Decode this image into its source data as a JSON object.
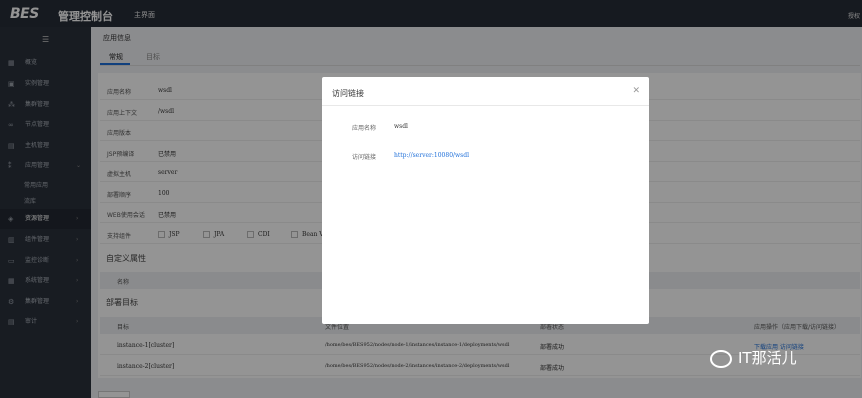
{
  "header": {
    "logo": "BES",
    "console": "管理控制台",
    "home_tab": "主界面",
    "auth": "授权"
  },
  "sidebar": {
    "items": [
      {
        "label": "概览",
        "icon": "grid-icon"
      },
      {
        "label": "实例管理",
        "icon": "instance-icon"
      },
      {
        "label": "集群管理",
        "icon": "cluster-icon"
      },
      {
        "label": "节点管理",
        "icon": "node-icon"
      },
      {
        "label": "主机管理",
        "icon": "host-icon"
      },
      {
        "label": "应用管理",
        "icon": "app-icon"
      },
      {
        "label": "常用应用",
        "icon": ""
      },
      {
        "label": "流库",
        "icon": ""
      },
      {
        "label": "资源管理",
        "icon": "resource-icon"
      },
      {
        "label": "组件管理",
        "icon": "component-icon"
      },
      {
        "label": "监控诊断",
        "icon": "monitor-icon"
      },
      {
        "label": "系统管理",
        "icon": "system-icon"
      },
      {
        "label": "集群管理",
        "icon": "gear-icon"
      },
      {
        "label": "审计",
        "icon": "audit-icon"
      }
    ]
  },
  "breadcrumb": "应用信息",
  "tabs": {
    "general": "常规",
    "target": "目标"
  },
  "info_rows": [
    {
      "k": "应用名称",
      "v": "wsdl"
    },
    {
      "k": "应用上下文",
      "v": "/wsdl"
    },
    {
      "k": "应用版本",
      "v": ""
    },
    {
      "k": "JSP预编译",
      "v": "已禁用"
    },
    {
      "k": "虚拟主机",
      "v": "server"
    },
    {
      "k": "部署顺序",
      "v": "100"
    },
    {
      "k": "WEB使用会话",
      "v": "已禁用"
    }
  ],
  "support_label": "支持组件",
  "support_options": [
    "JSP",
    "JPA",
    "CDI",
    "Bean Validation"
  ],
  "custom_props": "自定义属性",
  "custom_header": "名称",
  "deploy_target": "部署目标",
  "table_headers": {
    "target": "目标",
    "path": "文件位置",
    "status": "部署状态",
    "ops": "应用操作（应用下载/访问链接）"
  },
  "table_rows": [
    {
      "target": "instance-1[cluster]",
      "path": "/home/bes/BES952/nodes/node-1/instances/instance-1/deployments/wsdl",
      "status": "部署成功",
      "ops": "下载应用 访问链接"
    },
    {
      "target": "instance-2[cluster]",
      "path": "/home/bes/BES952/nodes/node-2/instances/instance-2/deployments/wsdl",
      "status": "部署成功",
      "ops": ""
    }
  ],
  "modal": {
    "title": "访问链接",
    "app_name_label": "应用名称",
    "app_name": "wsdl",
    "link_label": "访问链接",
    "link": "http://server:10080/wsdl"
  },
  "watermark": "IT那活儿"
}
